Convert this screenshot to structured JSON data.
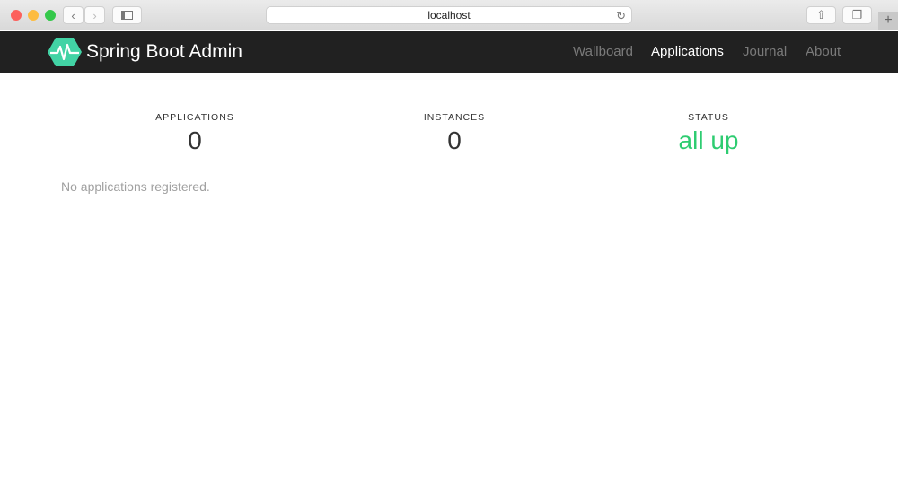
{
  "browser": {
    "url": "localhost",
    "back_icon": "‹",
    "forward_icon": "›",
    "new_tab_icon": "+"
  },
  "nav": {
    "brand": "Spring Boot Admin",
    "links": [
      "Wallboard",
      "Applications",
      "Journal",
      "About"
    ],
    "active": "Applications"
  },
  "stats": {
    "applications_label": "APPLICATIONS",
    "applications_value": "0",
    "instances_label": "INSTANCES",
    "instances_value": "0",
    "status_label": "STATUS",
    "status_value": "all up"
  },
  "colors": {
    "status_up": "#2ecc71",
    "logo": "#42d3a5",
    "navbar": "#212121"
  },
  "message": "No applications registered."
}
